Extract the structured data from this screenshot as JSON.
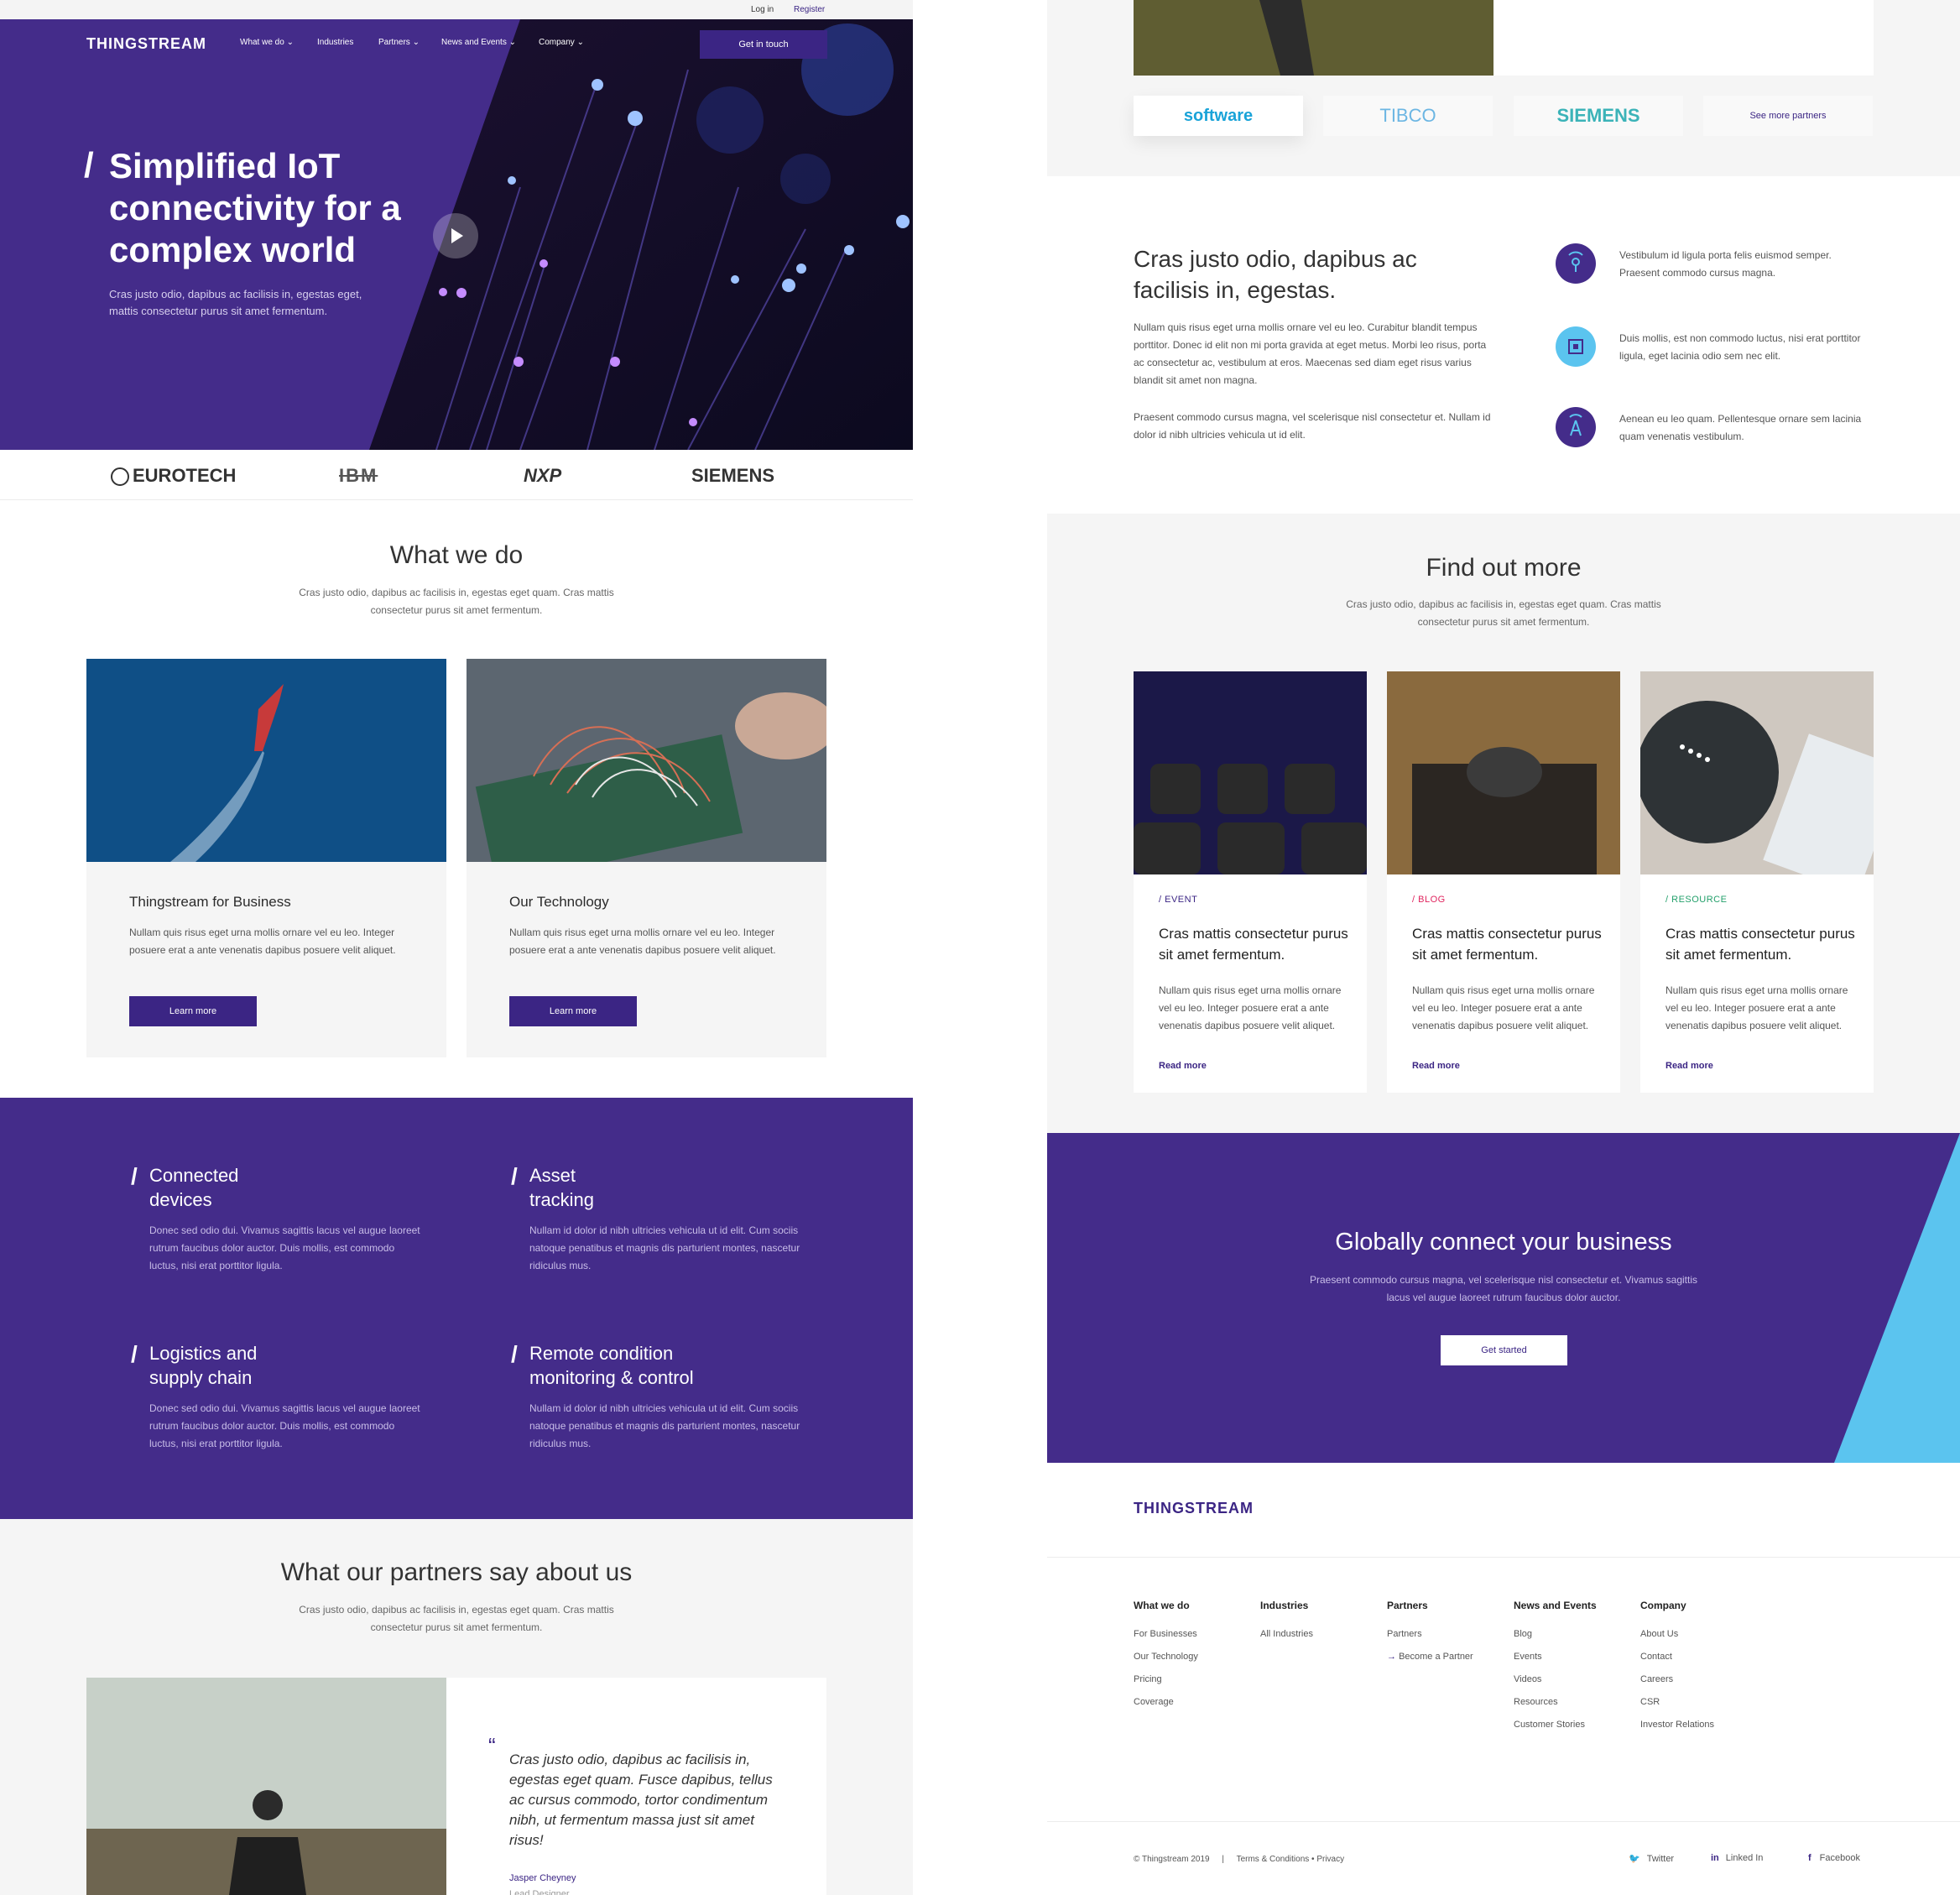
{
  "topbar": {
    "login": "Log in",
    "register": "Register"
  },
  "nav": {
    "logo": "THINGSTREAM",
    "items": [
      "What we do",
      "Industries",
      "Partners",
      "News and Events",
      "Company"
    ],
    "cta": "Get in touch"
  },
  "hero": {
    "slash": "/",
    "title": "Simplified IoT connectivity for a complex world",
    "subtitle": "Cras justo odio, dapibus ac facilisis in, egestas eget, mattis consectetur purus sit amet fermentum."
  },
  "logos_top": [
    "EUROTECH",
    "IBM",
    "NXP",
    "SIEMENS"
  ],
  "what_we_do": {
    "title": "What we do",
    "subtitle": "Cras justo odio, dapibus ac facilisis in, egestas eget quam. Cras mattis consectetur purus sit amet fermentum.",
    "cards": [
      {
        "title": "Thingstream for Business",
        "body": "Nullam quis risus eget urna mollis ornare vel eu leo. Integer posuere erat a ante venenatis dapibus posuere velit aliquet.",
        "button": "Learn more"
      },
      {
        "title": "Our Technology",
        "body": "Nullam quis risus eget urna mollis ornare vel eu leo. Integer posuere erat a ante venenatis dapibus posuere velit aliquet.",
        "button": "Learn more"
      }
    ]
  },
  "features": [
    {
      "title": "Connected devices",
      "body": "Donec sed odio dui. Vivamus sagittis lacus vel augue laoreet rutrum faucibus dolor auctor. Duis mollis, est commodo luctus, nisi erat porttitor ligula."
    },
    {
      "title": "Asset tracking",
      "body": "Nullam id dolor id nibh ultricies vehicula ut id elit. Cum sociis natoque penatibus et magnis dis parturient montes, nascetur ridiculus mus."
    },
    {
      "title": "Logistics and supply chain",
      "body": "Donec sed odio dui. Vivamus sagittis lacus vel augue laoreet rutrum faucibus dolor auctor. Duis mollis, est commodo luctus, nisi erat porttitor ligula."
    },
    {
      "title": "Remote condition monitoring & control",
      "body": "Nullam id dolor id nibh ultricies vehicula ut id elit. Cum sociis natoque penatibus et magnis dis parturient montes, nascetur ridiculus mus."
    }
  ],
  "partners_say": {
    "title": "What our partners say about us",
    "subtitle": "Cras justo odio, dapibus ac facilisis in, egestas eget quam. Cras mattis consectetur purus sit amet fermentum.",
    "quote": "Cras justo odio, dapibus ac facilisis in, egestas eget quam. Fusce dapibus, tellus ac cursus commodo, tortor condimentum nibh, ut fermentum massa just sit amet risus!",
    "name": "Jasper Cheyney",
    "role": "Lead Designer"
  },
  "partner_logos": [
    "software",
    "TIBCO",
    "SIEMENS"
  ],
  "see_more": "See more partners",
  "info": {
    "title": "Cras justo odio, dapibus ac facilisis in, egestas.",
    "p1": "Nullam quis risus eget urna mollis ornare vel eu leo. Curabitur blandit tempus porttitor. Donec id elit non mi porta gravida at eget metus. Morbi leo risus, porta ac consectetur ac, vestibulum at eros. Maecenas sed diam eget risus varius blandit sit amet non magna.",
    "p2": "Praesent commodo cursus magna, vel scelerisque nisl consectetur et. Nullam id dolor id nibh ultricies vehicula ut id elit.",
    "items": [
      "Vestibulum id ligula porta felis euismod semper. Praesent commodo cursus magna.",
      "Duis mollis, est non commodo luctus, nisi erat porttitor ligula, eget lacinia odio sem nec elit.",
      "Aenean eu leo quam. Pellentesque ornare sem lacinia quam venenatis vestibulum."
    ]
  },
  "find_out": {
    "title": "Find out more",
    "subtitle": "Cras justo odio, dapibus ac facilisis in, egestas eget quam. Cras mattis consectetur purus sit amet fermentum.",
    "cards": [
      {
        "tag": "EVENT",
        "title": "Cras mattis consectetur purus sit amet fermentum.",
        "body": "Nullam quis risus eget urna mollis ornare vel eu leo. Integer posuere erat a ante venenatis dapibus posuere velit aliquet.",
        "link": "Read more"
      },
      {
        "tag": "BLOG",
        "title": "Cras mattis consectetur purus sit amet fermentum.",
        "body": "Nullam quis risus eget urna mollis ornare vel eu leo. Integer posuere erat a ante venenatis dapibus posuere velit aliquet.",
        "link": "Read more"
      },
      {
        "tag": "RESOURCE",
        "title": "Cras mattis consectetur purus sit amet fermentum.",
        "body": "Nullam quis risus eget urna mollis ornare vel eu leo. Integer posuere erat a ante venenatis dapibus posuere velit aliquet.",
        "link": "Read more"
      }
    ],
    "tag_colors": [
      "#3b2584",
      "#e0245e",
      "#23a06b"
    ]
  },
  "cta": {
    "title": "Globally connect your business",
    "subtitle": "Praesent commodo cursus magna, vel scelerisque nisl consectetur et. Vivamus sagittis lacus vel augue laoreet rutrum faucibus dolor auctor.",
    "button": "Get started"
  },
  "footer": {
    "logo": "THINGSTREAM",
    "columns": [
      {
        "head": "What we do",
        "links": [
          "For Businesses",
          "Our Technology",
          "Pricing",
          "Coverage"
        ]
      },
      {
        "head": "Industries",
        "links": [
          "All Industries"
        ]
      },
      {
        "head": "Partners",
        "links": [
          "Partners",
          "Become a Partner"
        ]
      },
      {
        "head": "News and Events",
        "links": [
          "Blog",
          "Events",
          "Videos",
          "Resources",
          "Customer Stories"
        ]
      },
      {
        "head": "Company",
        "links": [
          "About Us",
          "Contact",
          "Careers",
          "CSR",
          "Investor Relations"
        ]
      }
    ],
    "copyright": "© Thingstream 2019",
    "separator": "|",
    "legal": "Terms & Conditions • Privacy",
    "social": [
      "Twitter",
      "Linked In",
      "Facebook"
    ]
  },
  "colors": {
    "brand_purple": "#442c8a",
    "accent_blue": "#5bc4ef"
  }
}
